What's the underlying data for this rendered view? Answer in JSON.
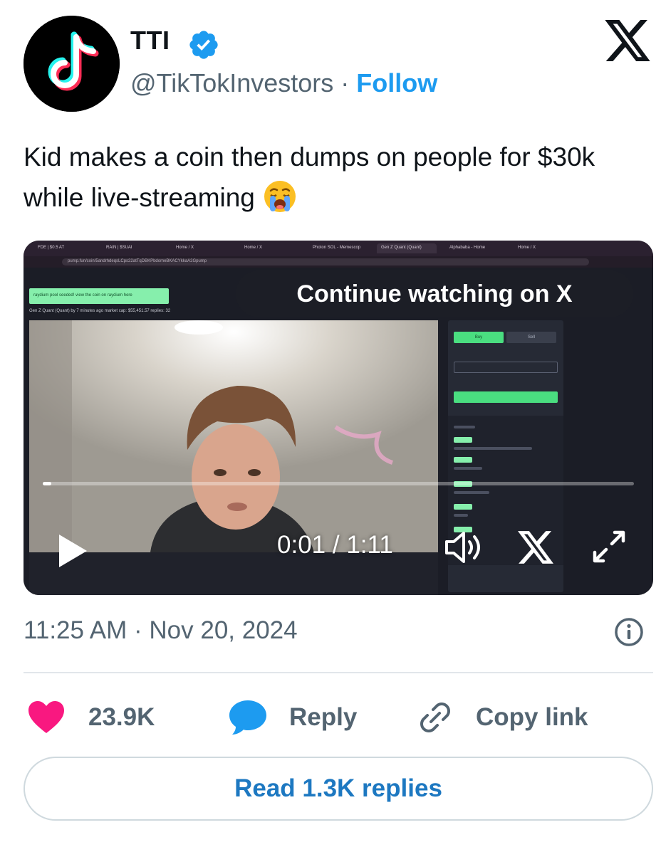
{
  "author": {
    "name": "TTI",
    "handle": "@TikTokInvestors",
    "separator": "·",
    "follow_label": "Follow",
    "avatar_icon": "tiktok-logo-icon",
    "verified_icon": "verified-badge-icon",
    "verified_color": "#1d9bf0"
  },
  "platform_logo": "x-logo-icon",
  "tweet": {
    "text": "Kid makes a coin then dumps on people for $30k while live-streaming",
    "emoji": "loudly-crying-face"
  },
  "video": {
    "overlay_label": "Continue watching on X",
    "progress": 0.014,
    "current_time": "0:01",
    "duration": "1:11",
    "time_separator": " / ",
    "controls": [
      "play-icon",
      "volume-icon",
      "x-logo-icon",
      "fullscreen-icon"
    ],
    "embedded_screen": {
      "tabs": [
        "FDE | $0.5 AT",
        "RAIN | $SUAI",
        "Home / X",
        "Home / X",
        "Photon SOL - Memescop",
        "Gen Z Quant (Quant)",
        "Alphababa - Home",
        "Home / X"
      ],
      "address": "pump.fun/coin/5andrhdeqsLCps22atTqDBKPbdomeBKACYkkaA2Gpump",
      "toast": "raydium pool seeded! view the coin on raydium here",
      "coin_info": "Gen Z Quant (Quant)   by   7 minutes ago   market cap: $55,451.57   replies: 32",
      "buy_label": "Buy",
      "sell_label": "Sell"
    }
  },
  "meta": {
    "time": "11:25 AM",
    "separator": "·",
    "date": "Nov 20, 2024"
  },
  "actions": {
    "like_count": "23.9K",
    "like_color": "#f91880",
    "reply_label": "Reply",
    "reply_color": "#1d9bf0",
    "copy_label": "Copy link"
  },
  "read_replies_label": "Read 1.3K replies"
}
